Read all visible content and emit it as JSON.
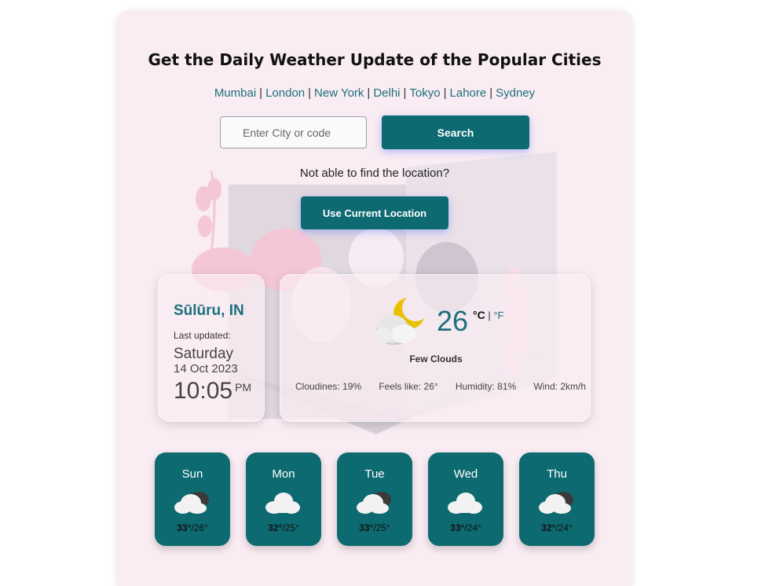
{
  "header": {
    "title": "Get the Daily Weather Update of the Popular Cities"
  },
  "cities": [
    "Mumbai",
    "London",
    "New York",
    "Delhi",
    "Tokyo",
    "Lahore",
    "Sydney"
  ],
  "search": {
    "placeholder": "Enter City or code",
    "value": "",
    "button_label": "Search"
  },
  "location": {
    "prompt": "Not able to find the location?",
    "button_label": "Use Current Location"
  },
  "current": {
    "place": "Sūlūru, IN",
    "last_updated_label": "Last updated:",
    "day": "Saturday",
    "date": "14 Oct 2023",
    "time": "10:05",
    "ampm": "PM",
    "temperature": "26",
    "unit_c": "°C",
    "unit_sep": "|",
    "unit_f": "°F",
    "condition": "Few Clouds",
    "condition_icon": "partly-cloudy-night-icon",
    "stats": {
      "cloudiness": "Cloudines: 19%",
      "feels_like": "Feels like: 26°",
      "humidity": "Humidity: 81%",
      "wind": "Wind: 2km/h"
    }
  },
  "forecast": [
    {
      "day": "Sun",
      "high": "33°",
      "low": "/26°",
      "icon": "broken-clouds-icon"
    },
    {
      "day": "Mon",
      "high": "32°",
      "low": "/25°",
      "icon": "cloud-icon"
    },
    {
      "day": "Tue",
      "high": "33°",
      "low": "/25°",
      "icon": "broken-clouds-icon"
    },
    {
      "day": "Wed",
      "high": "33°",
      "low": "/24°",
      "icon": "cloud-icon"
    },
    {
      "day": "Thu",
      "high": "32°",
      "low": "/24°",
      "icon": "broken-clouds-icon"
    }
  ],
  "colors": {
    "accent": "#0d6a70",
    "link": "#1d6f7d",
    "card_background": "#f9ecf2"
  }
}
